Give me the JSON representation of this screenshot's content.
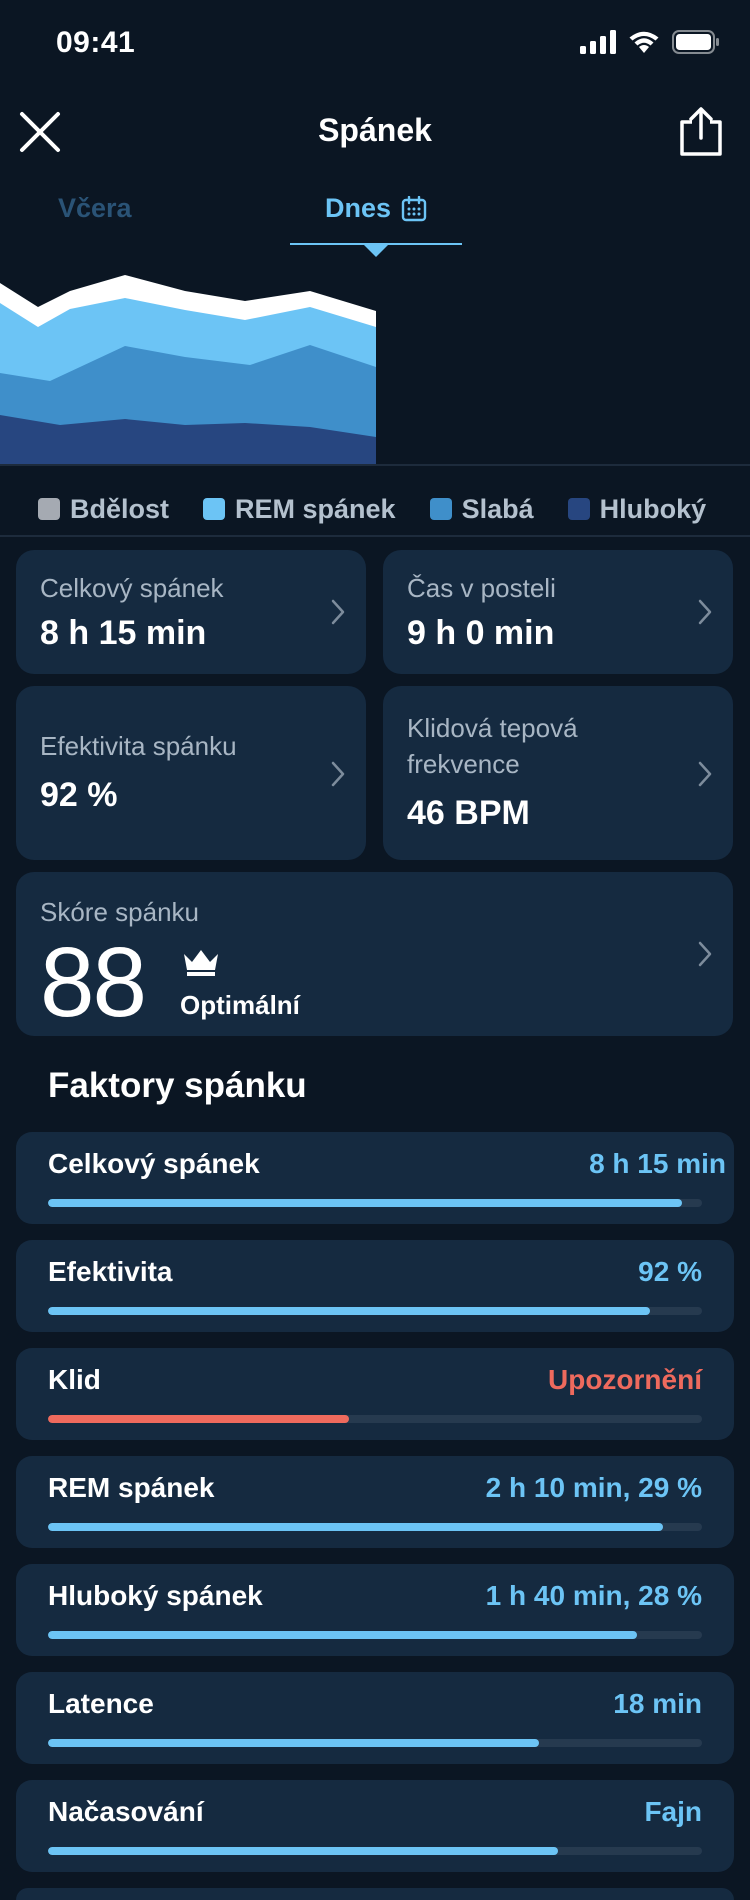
{
  "status_bar": {
    "time": "09:41"
  },
  "header": {
    "title": "Spánek"
  },
  "tabs": {
    "previous": "Včera",
    "active": "Dnes"
  },
  "chart_data": {
    "type": "area",
    "series": [
      {
        "name": "Bdělost",
        "color": "#ffffff"
      },
      {
        "name": "REM spánek",
        "color": "#6cc4f5"
      },
      {
        "name": "Slabá",
        "color": "#3f8fca"
      },
      {
        "name": "Hluboký",
        "color": "#274680"
      }
    ]
  },
  "legend": [
    {
      "label": "Bdělost",
      "color": "#a5aab2"
    },
    {
      "label": "REM spánek",
      "color": "#6cc4f5"
    },
    {
      "label": "Slabá",
      "color": "#3f8fca"
    },
    {
      "label": "Hluboký",
      "color": "#274680"
    }
  ],
  "stats": {
    "total_sleep": {
      "label": "Celkový spánek",
      "value": "8 h 15 min"
    },
    "time_in_bed": {
      "label": "Čas v posteli",
      "value": "9 h 0 min"
    },
    "efficiency": {
      "label": "Efektivita spánku",
      "value": "92 %"
    },
    "resting_hr": {
      "label": "Klidová tepová frekvence",
      "value": "46 BPM"
    }
  },
  "score": {
    "label": "Skóre spánku",
    "value": "88",
    "description": "Optimální"
  },
  "factors_title": "Faktory spánku",
  "factors": [
    {
      "name": "Celkový spánek",
      "value": "8 h 15 min",
      "level": 0.97,
      "status": "ok"
    },
    {
      "name": "Efektivita",
      "value": "92 %",
      "level": 0.92,
      "status": "ok"
    },
    {
      "name": "Klid",
      "value": "Upozornění",
      "level": 0.46,
      "status": "warning"
    },
    {
      "name": "REM spánek",
      "value": "2 h 10 min, 29 %",
      "level": 0.94,
      "status": "ok"
    },
    {
      "name": "Hluboký spánek",
      "value": "1 h 40 min, 28 %",
      "level": 0.9,
      "status": "ok"
    },
    {
      "name": "Latence",
      "value": "18 min",
      "level": 0.75,
      "status": "ok"
    },
    {
      "name": "Načasování",
      "value": "Fajn",
      "level": 0.78,
      "status": "ok"
    }
  ],
  "colors": {
    "accent": "#6cc4f5",
    "warning": "#ee6a5d",
    "background": "#0b1623",
    "card": "#152a40"
  }
}
